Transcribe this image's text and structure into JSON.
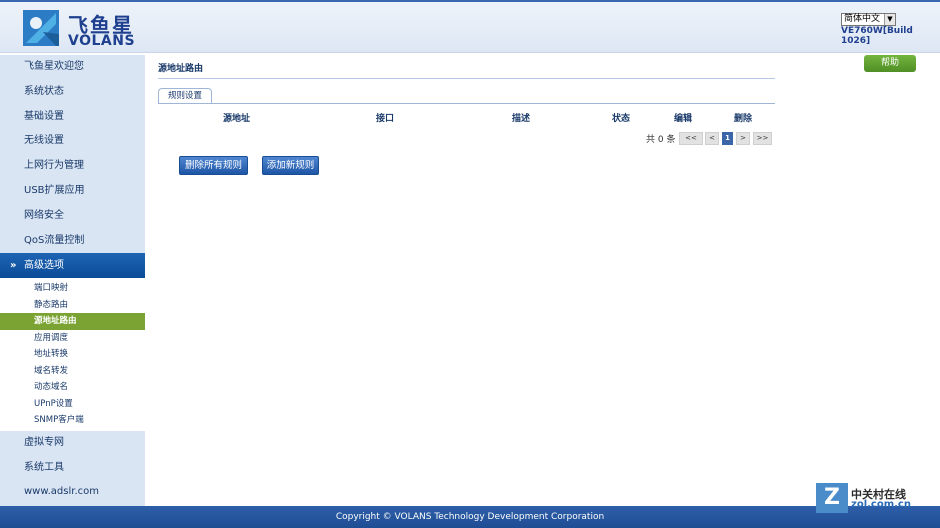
{
  "header": {
    "logo_cn": "飞鱼星",
    "logo_en": "VOLANS",
    "language": "简体中文",
    "build": "VE760W[Build 1026]"
  },
  "sidebar": {
    "items_top": [
      {
        "label": "飞鱼星欢迎您"
      },
      {
        "label": "系统状态"
      },
      {
        "label": "基础设置"
      },
      {
        "label": "无线设置"
      },
      {
        "label": "上网行为管理"
      },
      {
        "label": "USB扩展应用"
      },
      {
        "label": "网络安全"
      },
      {
        "label": "QoS流量控制"
      }
    ],
    "active_group": "高级选项",
    "sub_items": [
      {
        "label": "端口映射"
      },
      {
        "label": "静态路由"
      },
      {
        "label": "源地址路由"
      },
      {
        "label": "应用调度"
      },
      {
        "label": "地址转换"
      },
      {
        "label": "域名转发"
      },
      {
        "label": "动态域名"
      },
      {
        "label": "UPnP设置"
      },
      {
        "label": "SNMP客户端"
      }
    ],
    "active_sub": "源地址路由",
    "items_bottom": [
      {
        "label": "虚拟专网"
      },
      {
        "label": "系统工具"
      },
      {
        "label": "www.adslr.com"
      }
    ]
  },
  "main": {
    "title": "源地址路由",
    "help": "帮助",
    "tab": "规则设置",
    "columns": [
      "源地址",
      "接口",
      "描述",
      "状态",
      "编辑",
      "删除"
    ],
    "pager": {
      "count": "共 0 条",
      "first": "<<",
      "prev": "<",
      "current": "1",
      "next": ">",
      "last": ">>"
    },
    "buttons": {
      "delete_all": "删除所有规则",
      "add_new": "添加新规则"
    }
  },
  "footer": {
    "copyright": "Copyright © VOLANS Technology Development Corporation"
  },
  "watermark": {
    "letter": "Z",
    "cn": "中关村在线",
    "url": "zol.com.cn"
  },
  "colors": {
    "accent": "#1d64b3",
    "active_sub_bg": "#7aa334",
    "help_green": "#5f9f2f"
  }
}
